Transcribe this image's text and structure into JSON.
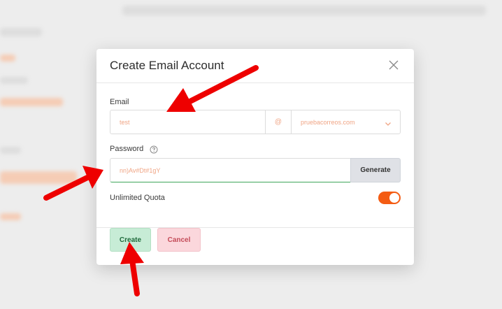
{
  "modal": {
    "title": "Create Email Account"
  },
  "form": {
    "email_label": "Email",
    "email_value": "test",
    "at_symbol": "@",
    "domain_value": "pruebacorreos.com",
    "password_label": "Password",
    "password_value": "nn)Av#Dt#1gY",
    "generate_label": "Generate",
    "quota_label": "Unlimited Quota",
    "quota_enabled": true
  },
  "footer": {
    "create_label": "Create",
    "cancel_label": "Cancel"
  },
  "colors": {
    "accent_orange": "#f45c13",
    "placeholder_text": "#f0a585",
    "arrow_red": "#ee0000"
  }
}
